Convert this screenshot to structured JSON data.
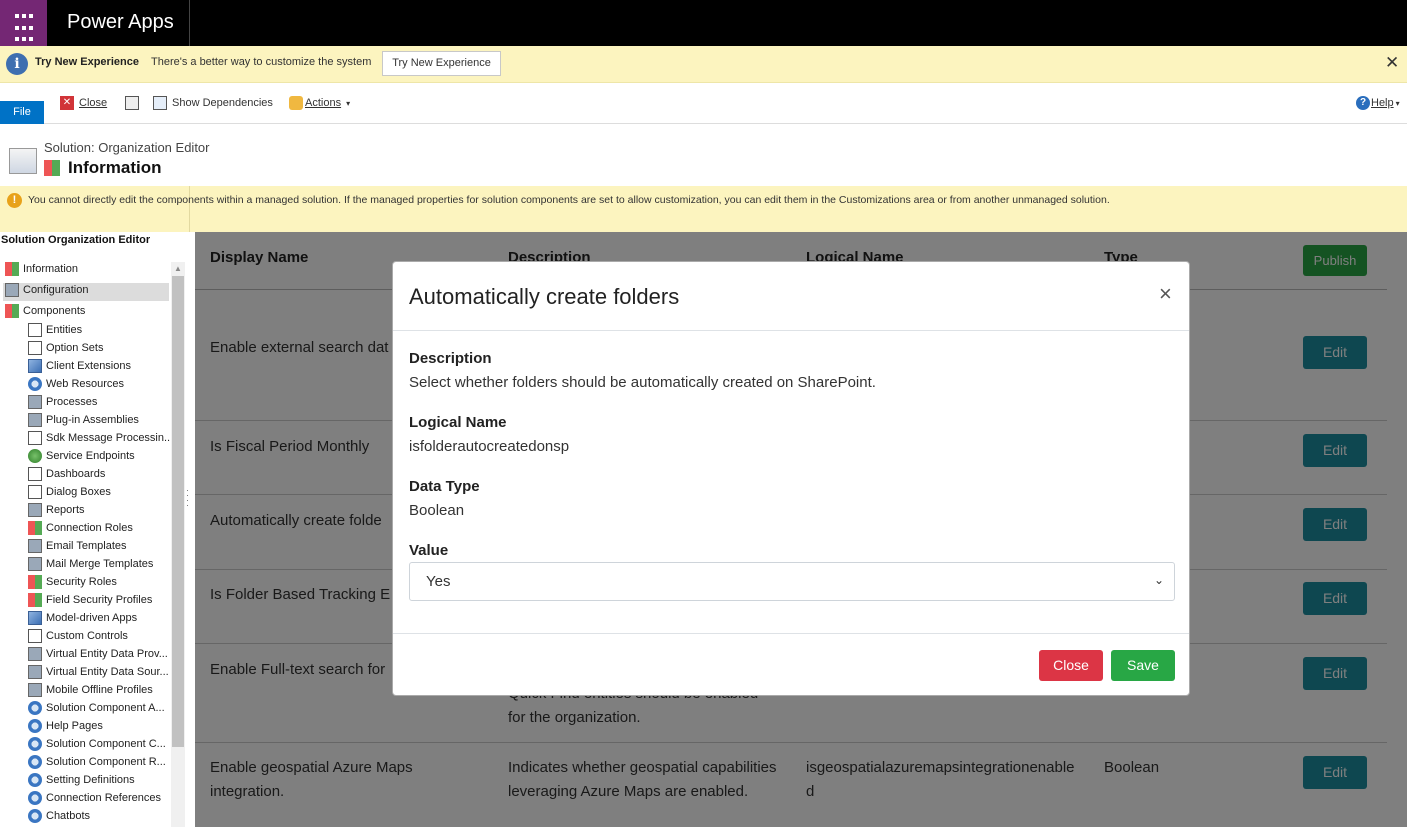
{
  "app": {
    "title": "Power Apps"
  },
  "notice": {
    "title": "Try New Experience",
    "message": "There's a better way to customize the system",
    "button_label": "Try New Experience",
    "close_glyph": "✕"
  },
  "toolbar": {
    "file_label": "File",
    "close_label": "Close",
    "show_dependencies_label": "Show Dependencies",
    "actions_label": "Actions",
    "help_label": "Help"
  },
  "header": {
    "solution_label": "Solution: Organization Editor",
    "page_title": "Information"
  },
  "warning": {
    "message": "You cannot directly edit the components within a managed solution. If the managed properties for solution components are set to allow customization, you can edit them in the Customizations area or from another unmanaged solution."
  },
  "nav": {
    "title": "Solution Organization Editor",
    "items": [
      {
        "label": "Information",
        "icon": "information-icon"
      },
      {
        "label": "Configuration",
        "icon": "configuration-icon"
      },
      {
        "label": "Components",
        "icon": "components-icon"
      },
      {
        "label": "Entities",
        "icon": "entities-icon"
      },
      {
        "label": "Option Sets",
        "icon": "option-sets-icon"
      },
      {
        "label": "Client Extensions",
        "icon": "client-extensions-icon"
      },
      {
        "label": "Web Resources",
        "icon": "web-resources-icon"
      },
      {
        "label": "Processes",
        "icon": "processes-icon"
      },
      {
        "label": "Plug-in Assemblies",
        "icon": "plugin-assemblies-icon"
      },
      {
        "label": "Sdk Message Processin...",
        "icon": "sdk-message-icon"
      },
      {
        "label": "Service Endpoints",
        "icon": "service-endpoints-icon"
      },
      {
        "label": "Dashboards",
        "icon": "dashboards-icon"
      },
      {
        "label": "Dialog Boxes",
        "icon": "dialog-boxes-icon"
      },
      {
        "label": "Reports",
        "icon": "reports-icon"
      },
      {
        "label": "Connection Roles",
        "icon": "connection-roles-icon"
      },
      {
        "label": "Email Templates",
        "icon": "email-templates-icon"
      },
      {
        "label": "Mail Merge Templates",
        "icon": "mail-merge-icon"
      },
      {
        "label": "Security Roles",
        "icon": "security-roles-icon"
      },
      {
        "label": "Field Security Profiles",
        "icon": "field-security-icon"
      },
      {
        "label": "Model-driven Apps",
        "icon": "model-driven-apps-icon"
      },
      {
        "label": "Custom Controls",
        "icon": "custom-controls-icon"
      },
      {
        "label": "Virtual Entity Data Prov...",
        "icon": "virtual-entity-provider-icon"
      },
      {
        "label": "Virtual Entity Data Sour...",
        "icon": "virtual-entity-source-icon"
      },
      {
        "label": "Mobile Offline Profiles",
        "icon": "mobile-offline-icon"
      },
      {
        "label": "Solution Component A...",
        "icon": "solution-component-icon"
      },
      {
        "label": "Help Pages",
        "icon": "help-pages-icon"
      },
      {
        "label": "Solution Component C...",
        "icon": "solution-component-icon"
      },
      {
        "label": "Solution Component R...",
        "icon": "solution-component-icon"
      },
      {
        "label": "Setting Definitions",
        "icon": "setting-definitions-icon"
      },
      {
        "label": "Connection References",
        "icon": "connection-references-icon"
      },
      {
        "label": "Chatbots",
        "icon": "chatbots-icon"
      }
    ]
  },
  "grid": {
    "headers": [
      "Display Name",
      "Description",
      "Logical Name",
      "Type"
    ],
    "publish_label": "Publish",
    "edit_label": "Edit",
    "rows": [
      {
        "display": "Enable external search dat",
        "description": "",
        "logical": "",
        "type": ""
      },
      {
        "display": "Is Fiscal Period Monthly",
        "description": "",
        "logical": "",
        "type": ""
      },
      {
        "display": "Automatically create folde",
        "description": "",
        "logical": "",
        "type": ""
      },
      {
        "display": "Is Folder Based Tracking E",
        "description": "",
        "logical": "",
        "type": ""
      },
      {
        "display": "Enable Full-text search for",
        "description": "Quick Find entities should be enabled for the organization.",
        "logical": "",
        "type": ""
      },
      {
        "display": "Enable geospatial Azure Maps integration.",
        "description": "Indicates whether geospatial capabilities leveraging Azure Maps are enabled.",
        "logical": "isgeospatialazuremapsintegrationenabled",
        "type": "Boolean"
      }
    ]
  },
  "modal": {
    "title": "Automatically create folders",
    "close_glyph": "×",
    "description_label": "Description",
    "description_value": "Select whether folders should be automatically created on SharePoint.",
    "logical_name_label": "Logical Name",
    "logical_name_value": "isfolderautocreatedonsp",
    "data_type_label": "Data Type",
    "data_type_value": "Boolean",
    "value_label": "Value",
    "value_selected": "Yes",
    "close_button": "Close",
    "save_button": "Save"
  }
}
